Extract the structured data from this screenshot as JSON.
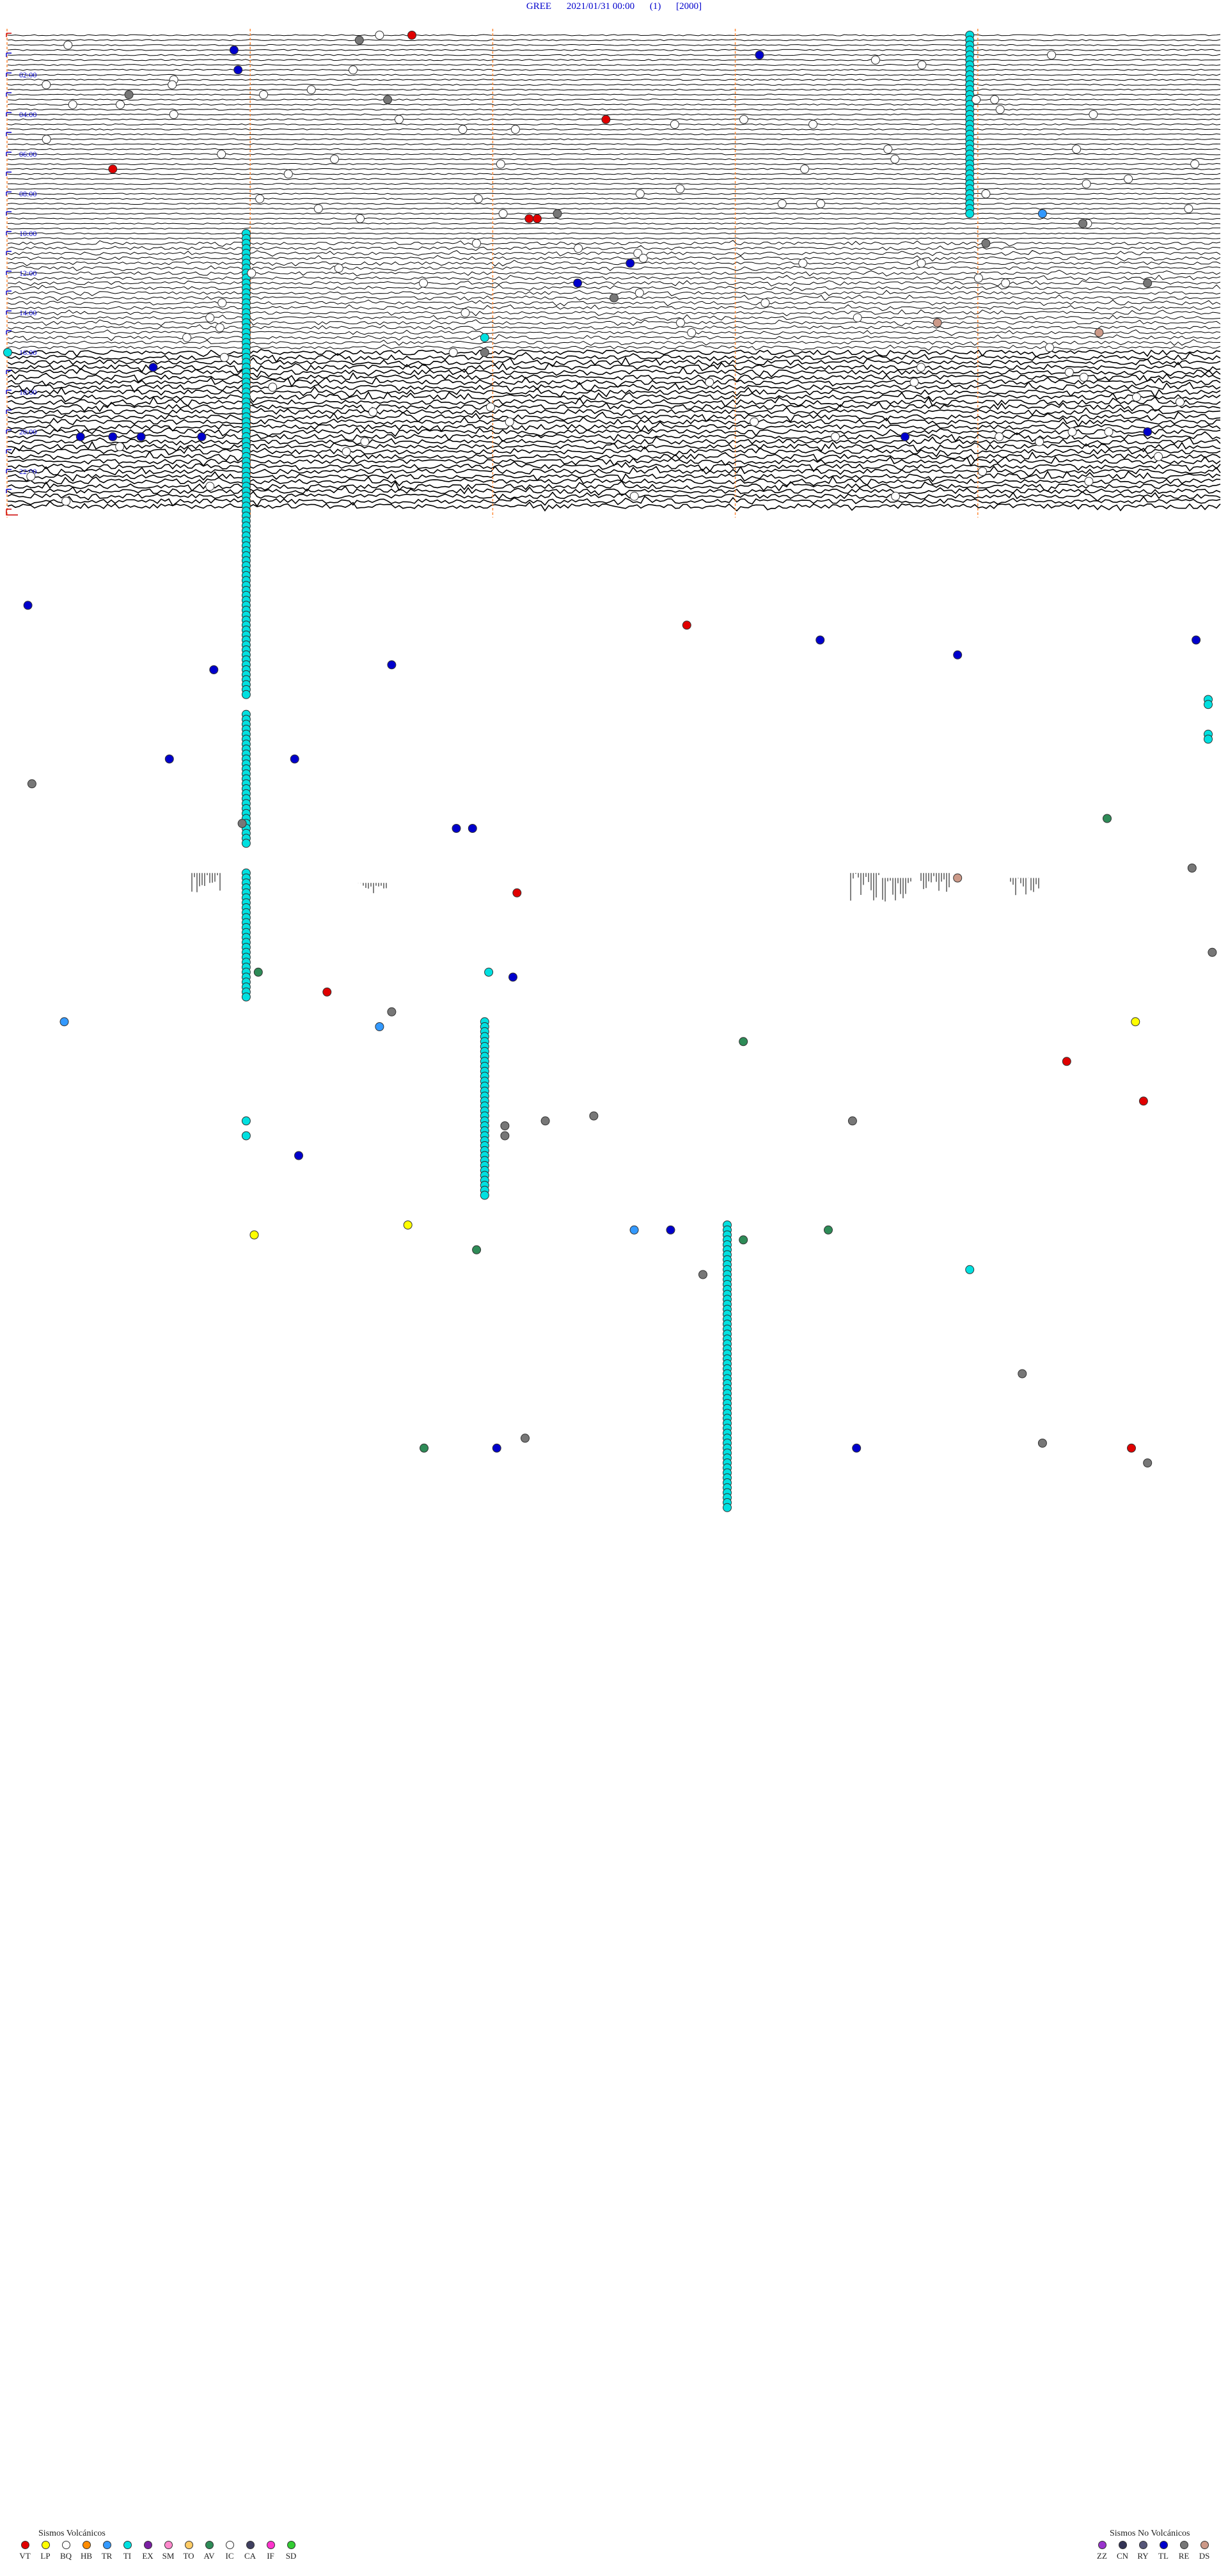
{
  "header": {
    "station": "GREE",
    "datetime": "2021/01/31 00:00",
    "component": "(1)",
    "gain": "[2000]"
  },
  "legend": {
    "volcanic_title": "Sismos Volcánicos",
    "volcanic": [
      {
        "code": "VT",
        "color": "#e00000"
      },
      {
        "code": "LP",
        "color": "#ffff00"
      },
      {
        "code": "BQ",
        "color": "#ffffff"
      },
      {
        "code": "HB",
        "color": "#ff8c00"
      },
      {
        "code": "TR",
        "color": "#3399ff"
      },
      {
        "code": "TI",
        "color": "#00e0e0"
      },
      {
        "code": "EX",
        "color": "#7a1fa2"
      },
      {
        "code": "SM",
        "color": "#ff88cc"
      },
      {
        "code": "TO",
        "color": "#ffcc66"
      },
      {
        "code": "AV",
        "color": "#2e8b57"
      },
      {
        "code": "IC",
        "color": "#ffffff"
      },
      {
        "code": "CA",
        "color": "#404060"
      },
      {
        "code": "IF",
        "color": "#ff33cc"
      },
      {
        "code": "SD",
        "color": "#33cc33"
      }
    ],
    "nonvolcanic_title": "Sismos No Volcánicos",
    "nonvolcanic": [
      {
        "code": "ZZ",
        "color": "#9933cc"
      },
      {
        "code": "CN",
        "color": "#333355"
      },
      {
        "code": "RY",
        "color": "#555577"
      },
      {
        "code": "TL",
        "color": "#0000cc"
      },
      {
        "code": "RE",
        "color": "#777777"
      },
      {
        "code": "DS",
        "color": "#cc9988"
      }
    ]
  },
  "chart_data": {
    "type": "helicorder",
    "rows_per_hour": 4,
    "row_minutes": 15,
    "hours": 24,
    "time_labels": [
      {
        "hour": 2,
        "label": "02:00"
      },
      {
        "hour": 4,
        "label": "04:00"
      },
      {
        "hour": 6,
        "label": "06:00"
      },
      {
        "hour": 8,
        "label": "08:00"
      },
      {
        "hour": 10,
        "label": "10:00"
      },
      {
        "hour": 12,
        "label": "12:00"
      },
      {
        "hour": 14,
        "label": "14:00"
      },
      {
        "hour": 16,
        "label": "16:00"
      },
      {
        "hour": 18,
        "label": "18:00"
      },
      {
        "hour": 20,
        "label": "20:00"
      },
      {
        "hour": 22,
        "label": "22:00"
      }
    ],
    "guide_minutes": [
      3,
      6,
      9,
      12
    ],
    "noise_periods": [
      {
        "from_row": 0,
        "to_row": 42,
        "level": 1
      },
      {
        "from_row": 42,
        "to_row": 64,
        "level": 2
      },
      {
        "from_row": 64,
        "to_row": 108,
        "level": 3
      },
      {
        "from_row": 108,
        "to_row": 124,
        "level": 1
      }
    ],
    "event_colors": {
      "white": "#ffffff",
      "blue": "#0000cc",
      "red": "#e00000",
      "cyan": "#00e0e0",
      "gray": "#777777",
      "green": "#2e8b57",
      "yellow": "#ffff00",
      "lightblue": "#3399ff",
      "tan": "#cc9988"
    },
    "tremor_columns": [
      {
        "minute": 11.9,
        "from_row": 0,
        "to_row": 36
      },
      {
        "minute": 2.95,
        "from_row": 40,
        "to_row": 133
      },
      {
        "minute": 2.95,
        "from_row": 137,
        "to_row": 163
      },
      {
        "minute": 2.95,
        "from_row": 169,
        "to_row": 194
      },
      {
        "minute": 5.9,
        "from_row": 199,
        "to_row": 234
      },
      {
        "minute": 8.9,
        "from_row": 240,
        "to_row": 297
      }
    ],
    "events": [
      {
        "row": 0,
        "minute": 4.6,
        "type": "white"
      },
      {
        "row": 0,
        "minute": 5.0,
        "type": "red"
      },
      {
        "row": 1,
        "minute": 4.35,
        "type": "gray"
      },
      {
        "row": 3,
        "minute": 2.8,
        "type": "blue"
      },
      {
        "row": 4,
        "minute": 9.3,
        "type": "blue"
      },
      {
        "row": 7,
        "minute": 2.85,
        "type": "blue"
      },
      {
        "row": 12,
        "minute": 1.5,
        "type": "gray"
      },
      {
        "row": 13,
        "minute": 4.7,
        "type": "gray"
      },
      {
        "row": 17,
        "minute": 7.4,
        "type": "red"
      },
      {
        "row": 27,
        "minute": 1.3,
        "type": "red"
      },
      {
        "row": 37,
        "minute": 6.45,
        "type": "red"
      },
      {
        "row": 37,
        "minute": 6.55,
        "type": "red"
      },
      {
        "row": 36,
        "minute": 6.8,
        "type": "gray"
      },
      {
        "row": 36,
        "minute": 12.8,
        "type": "lightblue"
      },
      {
        "row": 38,
        "minute": 13.3,
        "type": "gray"
      },
      {
        "row": 42,
        "minute": 12.1,
        "type": "gray"
      },
      {
        "row": 46,
        "minute": 7.7,
        "type": "blue"
      },
      {
        "row": 50,
        "minute": 7.05,
        "type": "blue"
      },
      {
        "row": 50,
        "minute": 14.1,
        "type": "gray"
      },
      {
        "row": 53,
        "minute": 7.5,
        "type": "gray"
      },
      {
        "row": 58,
        "minute": 11.5,
        "type": "tan"
      },
      {
        "row": 60,
        "minute": 13.5,
        "type": "tan"
      },
      {
        "row": 61,
        "minute": 5.9,
        "type": "cyan"
      },
      {
        "row": 64,
        "minute": 5.9,
        "type": "gray"
      },
      {
        "row": 64,
        "minute": 0.0,
        "type": "cyan"
      },
      {
        "row": 67,
        "minute": 1.8,
        "type": "blue"
      },
      {
        "row": 81,
        "minute": 0.9,
        "type": "blue"
      },
      {
        "row": 81,
        "minute": 1.3,
        "type": "blue"
      },
      {
        "row": 81,
        "minute": 1.65,
        "type": "blue"
      },
      {
        "row": 81,
        "minute": 2.4,
        "type": "blue"
      },
      {
        "row": 81,
        "minute": 11.1,
        "type": "blue"
      },
      {
        "row": 80,
        "minute": 14.1,
        "type": "blue"
      },
      {
        "row": 115,
        "minute": 0.25,
        "type": "blue"
      },
      {
        "row": 119,
        "minute": 8.4,
        "type": "red"
      },
      {
        "row": 122,
        "minute": 10.05,
        "type": "blue"
      },
      {
        "row": 122,
        "minute": 14.7,
        "type": "blue"
      },
      {
        "row": 125,
        "minute": 11.75,
        "type": "blue"
      },
      {
        "row": 127,
        "minute": 4.75,
        "type": "blue"
      },
      {
        "row": 128,
        "minute": 2.55,
        "type": "blue"
      },
      {
        "row": 134,
        "minute": 14.85,
        "type": "cyan"
      },
      {
        "row": 135,
        "minute": 14.85,
        "type": "cyan"
      },
      {
        "row": 141,
        "minute": 14.85,
        "type": "cyan"
      },
      {
        "row": 142,
        "minute": 14.85,
        "type": "cyan"
      },
      {
        "row": 146,
        "minute": 2.0,
        "type": "blue"
      },
      {
        "row": 146,
        "minute": 3.55,
        "type": "blue"
      },
      {
        "row": 151,
        "minute": 0.3,
        "type": "gray"
      },
      {
        "row": 159,
        "minute": 2.9,
        "type": "gray"
      },
      {
        "row": 160,
        "minute": 5.55,
        "type": "blue"
      },
      {
        "row": 160,
        "minute": 5.75,
        "type": "blue"
      },
      {
        "row": 158,
        "minute": 13.6,
        "type": "green"
      },
      {
        "row": 168,
        "minute": 14.65,
        "type": "gray"
      },
      {
        "row": 170,
        "minute": 11.75,
        "type": "tan"
      },
      {
        "row": 173,
        "minute": 6.3,
        "type": "red"
      },
      {
        "row": 185,
        "minute": 14.9,
        "type": "gray"
      },
      {
        "row": 189,
        "minute": 3.1,
        "type": "green"
      },
      {
        "row": 189,
        "minute": 5.95,
        "type": "cyan"
      },
      {
        "row": 190,
        "minute": 6.25,
        "type": "blue"
      },
      {
        "row": 193,
        "minute": 3.95,
        "type": "red"
      },
      {
        "row": 197,
        "minute": 4.75,
        "type": "gray"
      },
      {
        "row": 199,
        "minute": 0.7,
        "type": "lightblue"
      },
      {
        "row": 199,
        "minute": 13.95,
        "type": "yellow"
      },
      {
        "row": 200,
        "minute": 4.6,
        "type": "lightblue"
      },
      {
        "row": 203,
        "minute": 9.1,
        "type": "green"
      },
      {
        "row": 207,
        "minute": 13.1,
        "type": "red"
      },
      {
        "row": 215,
        "minute": 14.05,
        "type": "red"
      },
      {
        "row": 218,
        "minute": 7.25,
        "type": "gray"
      },
      {
        "row": 219,
        "minute": 6.65,
        "type": "gray"
      },
      {
        "row": 219,
        "minute": 10.45,
        "type": "gray"
      },
      {
        "row": 220,
        "minute": 6.15,
        "type": "gray"
      },
      {
        "row": 219,
        "minute": 2.95,
        "type": "cyan"
      },
      {
        "row": 222,
        "minute": 2.95,
        "type": "cyan"
      },
      {
        "row": 222,
        "minute": 6.15,
        "type": "gray"
      },
      {
        "row": 226,
        "minute": 3.6,
        "type": "blue"
      },
      {
        "row": 240,
        "minute": 4.95,
        "type": "yellow"
      },
      {
        "row": 242,
        "minute": 3.05,
        "type": "yellow"
      },
      {
        "row": 241,
        "minute": 7.75,
        "type": "lightblue"
      },
      {
        "row": 241,
        "minute": 8.2,
        "type": "blue"
      },
      {
        "row": 241,
        "minute": 10.15,
        "type": "green"
      },
      {
        "row": 243,
        "minute": 9.1,
        "type": "green"
      },
      {
        "row": 245,
        "minute": 5.8,
        "type": "green"
      },
      {
        "row": 249,
        "minute": 11.9,
        "type": "cyan"
      },
      {
        "row": 250,
        "minute": 8.6,
        "type": "gray"
      },
      {
        "row": 270,
        "minute": 12.55,
        "type": "gray"
      },
      {
        "row": 283,
        "minute": 6.4,
        "type": "gray"
      },
      {
        "row": 285,
        "minute": 6.05,
        "type": "blue"
      },
      {
        "row": 285,
        "minute": 10.5,
        "type": "blue"
      },
      {
        "row": 285,
        "minute": 13.9,
        "type": "red"
      },
      {
        "row": 285,
        "minute": 5.15,
        "type": "green"
      },
      {
        "row": 284,
        "minute": 12.8,
        "type": "gray"
      },
      {
        "row": 288,
        "minute": 14.1,
        "type": "gray"
      }
    ]
  }
}
